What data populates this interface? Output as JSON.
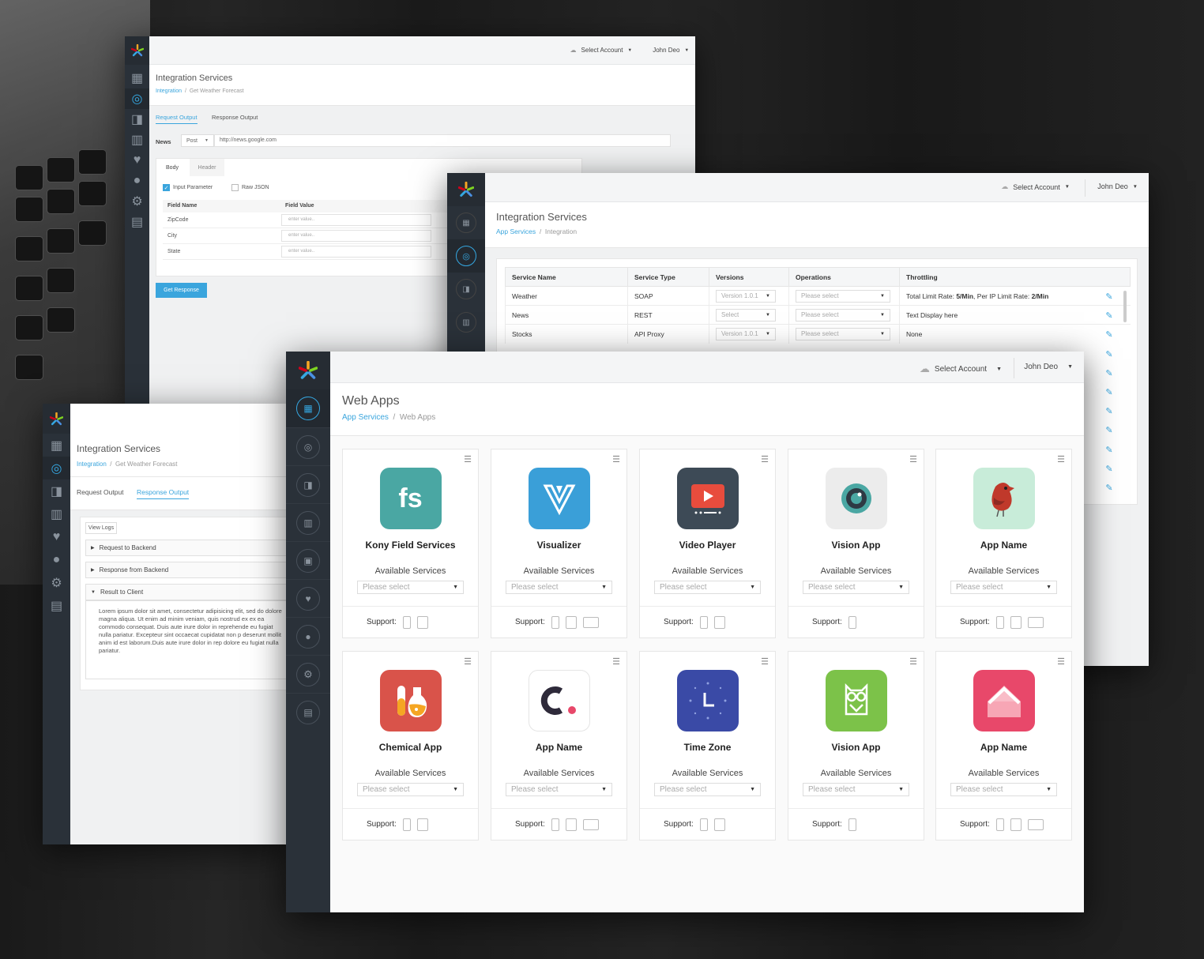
{
  "topbar": {
    "select_account": "Select Account",
    "user": "John Deo"
  },
  "window1": {
    "title": "Integration Services",
    "breadcrumb_link": "Integration",
    "breadcrumb_current": "Get Weather Forecast",
    "tabs": [
      "Request Output",
      "Response Output"
    ],
    "news_label": "News",
    "method": "Post",
    "url": "http://news.google.com",
    "subtabs": [
      "Body",
      "Header"
    ],
    "check_input": "Input Parameter",
    "check_raw": "Raw JSON",
    "col_field_name": "Field Name",
    "col_field_value": "Field Value",
    "rows": [
      "ZipCode",
      "City",
      "State"
    ],
    "value_placeholder": "enter value..",
    "button": "Get Response"
  },
  "window2": {
    "title": "Integration Services",
    "breadcrumb_link": "App Services",
    "breadcrumb_current": "Integration",
    "columns": [
      "Service Name",
      "Service Type",
      "Versions",
      "Operations",
      "Throttling"
    ],
    "rows": [
      {
        "name": "Weather",
        "type": "SOAP",
        "version": "Version 1.0.1",
        "ops": "Please select",
        "thr_pre": "Total Limit Rate: ",
        "thr_b1": "5/Min",
        "thr_mid": ", Per IP Limit Rate: ",
        "thr_b2": "2/Min"
      },
      {
        "name": "News",
        "type": "REST",
        "version": "Select",
        "ops": "Please select",
        "thr_pre": "Text Display here",
        "thr_b1": "",
        "thr_mid": "",
        "thr_b2": ""
      },
      {
        "name": "Stocks",
        "type": "API Proxy",
        "version": "Version 1.0.1",
        "ops": "Please select",
        "thr_pre": "None",
        "thr_b1": "",
        "thr_mid": "",
        "thr_b2": ""
      }
    ]
  },
  "window3": {
    "title": "Integration Services",
    "breadcrumb_link": "Integration",
    "breadcrumb_current": "Get Weather Forecast",
    "tabs": [
      "Request Output",
      "Response Output"
    ],
    "view_logs": "View Logs",
    "sections": [
      "Request to Backend",
      "Response from Backend",
      "Result to Client"
    ],
    "lorem": "Lorem ipsum dolor sit amet, consectetur adipisicing elit, sed do dolore magna aliqua. Ut enim ad minim veniam, quis nostrud ex ex ea commodo consequat. Duis aute irure dolor in reprehende eu fugiat nulla pariatur. Excepteur sint occaecat cupidatat non p deserunt mollit anim id est laborum.Duis aute irure dolor in rep dolore eu fugiat nulla pariatur."
  },
  "window4": {
    "title": "Web Apps",
    "breadcrumb_link": "App Services",
    "breadcrumb_current": "Web Apps",
    "available_services": "Available Services",
    "placeholder": "Please select",
    "support_label": "Support:",
    "apps": [
      {
        "name": "Kony Field Services",
        "icon": "fs-icon",
        "color": "#4aa7a3",
        "devices": [
          "phone",
          "tablet"
        ]
      },
      {
        "name": "Visualizer",
        "icon": "visualizer-icon",
        "color": "#3a9fd8",
        "devices": [
          "phone",
          "tablet",
          "desktop"
        ]
      },
      {
        "name": "Video Player",
        "icon": "video-player-icon",
        "color": "#3d4a56",
        "devices": [
          "phone",
          "tablet"
        ]
      },
      {
        "name": "Vision App",
        "icon": "camera-icon",
        "color": "#ececec",
        "devices": [
          "phone"
        ]
      },
      {
        "name": "App Name",
        "icon": "bird-icon",
        "color": "#c8ecd9",
        "devices": [
          "phone",
          "tablet",
          "desktop"
        ]
      },
      {
        "name": "Chemical App",
        "icon": "flask-icon",
        "color": "#d9534a",
        "devices": [
          "phone",
          "tablet"
        ]
      },
      {
        "name": "App Name",
        "icon": "c-logo-icon",
        "color": "#ffffff",
        "devices": [
          "phone",
          "tablet",
          "desktop"
        ]
      },
      {
        "name": "Time Zone",
        "icon": "clock-icon",
        "color": "#3a4aa6",
        "devices": [
          "phone",
          "tablet"
        ]
      },
      {
        "name": "Vision App",
        "icon": "owl-icon",
        "color": "#7cc249",
        "devices": [
          "phone"
        ]
      },
      {
        "name": "App Name",
        "icon": "home-icon",
        "color": "#e8486a",
        "devices": [
          "phone",
          "tablet",
          "desktop"
        ]
      }
    ]
  }
}
